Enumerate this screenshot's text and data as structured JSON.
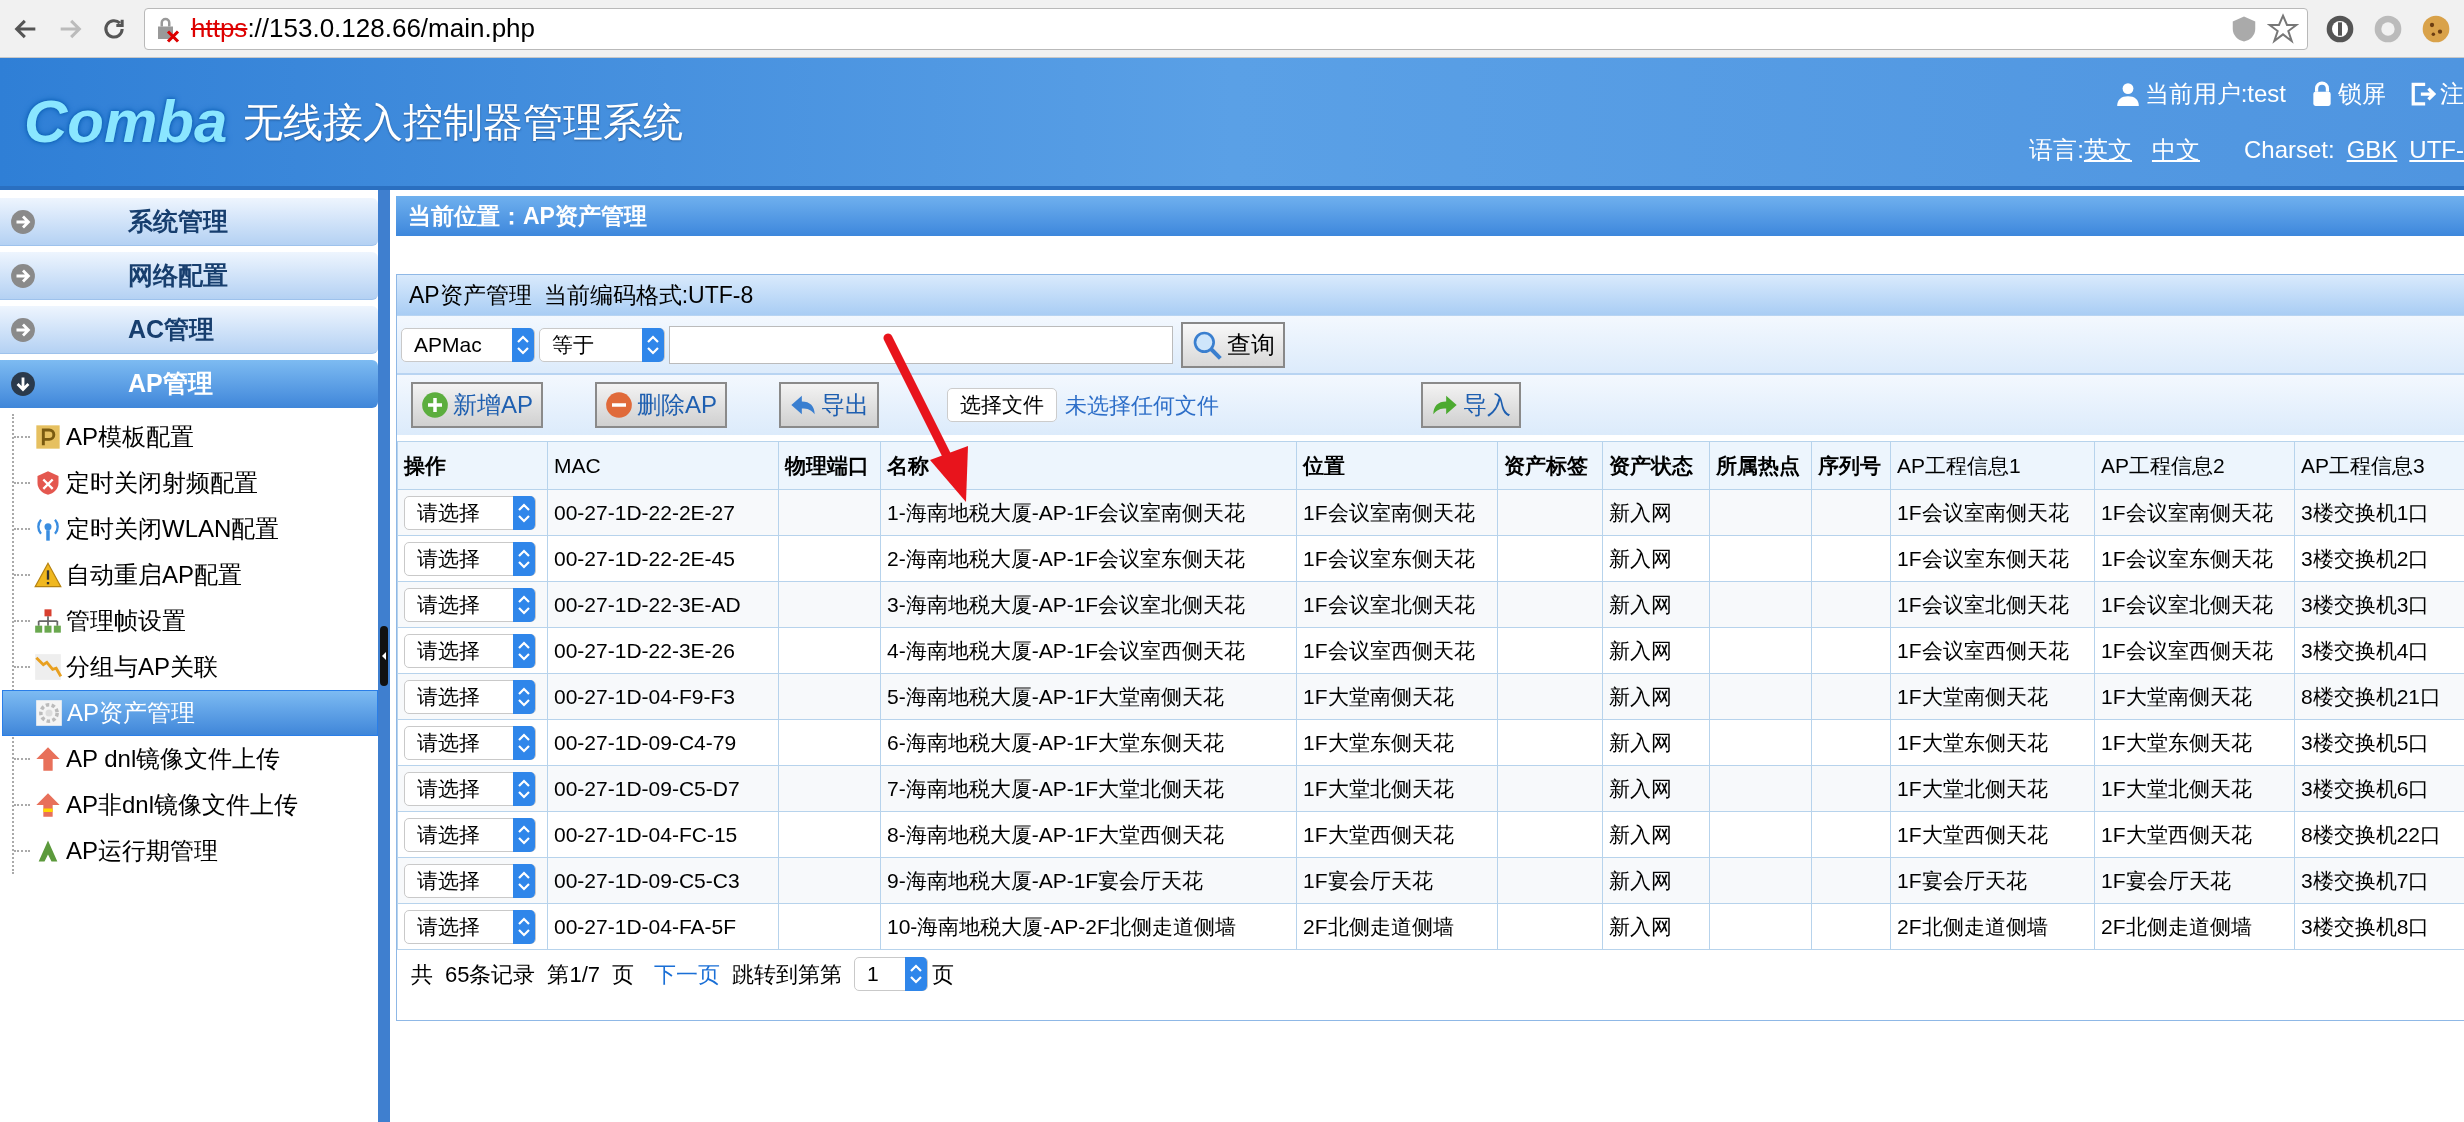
{
  "browser": {
    "url_scheme": "https",
    "url_rest": "://153.0.128.66/main.php"
  },
  "header": {
    "logo": "Comba",
    "title": "无线接入控制器管理系统",
    "user": "当前用户:test",
    "lock": "锁屏",
    "logout": "注",
    "language_label": "语言:",
    "languages": [
      "英文",
      "中文"
    ],
    "charset_label": "Charset:",
    "charsets": [
      "GBK",
      "UTF-"
    ]
  },
  "sidebar": {
    "sections": [
      {
        "label": "系统管理",
        "expanded": false
      },
      {
        "label": "网络配置",
        "expanded": false
      },
      {
        "label": "AC管理",
        "expanded": false
      },
      {
        "label": "AP管理",
        "expanded": true,
        "children": [
          {
            "label": "AP模板配置",
            "kind": "template",
            "selected": false
          },
          {
            "label": "定时关闭射频配置",
            "kind": "shield",
            "selected": false
          },
          {
            "label": "定时关闭WLAN配置",
            "kind": "wifi",
            "selected": false
          },
          {
            "label": "自动重启AP配置",
            "kind": "warning",
            "selected": false
          },
          {
            "label": "管理帧设置",
            "kind": "hierarchy",
            "selected": false
          },
          {
            "label": "分组与AP关联",
            "kind": "chart",
            "selected": false
          },
          {
            "label": "AP资产管理",
            "kind": "gear",
            "selected": true
          },
          {
            "label": "AP dnl镜像文件上传",
            "kind": "upload",
            "selected": false
          },
          {
            "label": "AP非dnl镜像文件上传",
            "kind": "upload-alt",
            "selected": false
          },
          {
            "label": "AP运行期管理",
            "kind": "tree",
            "selected": false
          }
        ]
      }
    ]
  },
  "breadcrumb": "当前位置：AP资产管理",
  "panel": {
    "title": "AP资产管理",
    "encoding": "当前编码格式:UTF-8",
    "search": {
      "field": "APMac",
      "operator": "等于",
      "button": "查询"
    },
    "actions": [
      {
        "label": "新增AP",
        "kind": "add"
      },
      {
        "label": "删除AP",
        "kind": "remove"
      },
      {
        "label": "导出",
        "kind": "export"
      }
    ],
    "file": {
      "button": "选择文件",
      "status": "未选择任何文件"
    },
    "import_button": "导入",
    "table": {
      "columns": [
        "操作",
        "MAC",
        "物理端口",
        "名称",
        "位置",
        "资产标签",
        "资产状态",
        "所属热点",
        "序列号",
        "AP工程信息1",
        "AP工程信息2",
        "AP工程信息3"
      ],
      "rows": [
        {
          "cells": [
            "请选择",
            "00-27-1D-22-2E-27",
            "",
            "1-海南地税大厦-AP-1F会议室南侧天花",
            "1F会议室南侧天花",
            "",
            "新入网",
            "",
            "",
            "1F会议室南侧天花",
            "1F会议室南侧天花",
            "3楼交换机1口"
          ]
        },
        {
          "cells": [
            "请选择",
            "00-27-1D-22-2E-45",
            "",
            "2-海南地税大厦-AP-1F会议室东侧天花",
            "1F会议室东侧天花",
            "",
            "新入网",
            "",
            "",
            "1F会议室东侧天花",
            "1F会议室东侧天花",
            "3楼交换机2口"
          ]
        },
        {
          "cells": [
            "请选择",
            "00-27-1D-22-3E-AD",
            "",
            "3-海南地税大厦-AP-1F会议室北侧天花",
            "1F会议室北侧天花",
            "",
            "新入网",
            "",
            "",
            "1F会议室北侧天花",
            "1F会议室北侧天花",
            "3楼交换机3口"
          ]
        },
        {
          "cells": [
            "请选择",
            "00-27-1D-22-3E-26",
            "",
            "4-海南地税大厦-AP-1F会议室西侧天花",
            "1F会议室西侧天花",
            "",
            "新入网",
            "",
            "",
            "1F会议室西侧天花",
            "1F会议室西侧天花",
            "3楼交换机4口"
          ]
        },
        {
          "cells": [
            "请选择",
            "00-27-1D-04-F9-F3",
            "",
            "5-海南地税大厦-AP-1F大堂南侧天花",
            "1F大堂南侧天花",
            "",
            "新入网",
            "",
            "",
            "1F大堂南侧天花",
            "1F大堂南侧天花",
            "8楼交换机21口"
          ]
        },
        {
          "cells": [
            "请选择",
            "00-27-1D-09-C4-79",
            "",
            "6-海南地税大厦-AP-1F大堂东侧天花",
            "1F大堂东侧天花",
            "",
            "新入网",
            "",
            "",
            "1F大堂东侧天花",
            "1F大堂东侧天花",
            "3楼交换机5口"
          ]
        },
        {
          "cells": [
            "请选择",
            "00-27-1D-09-C5-D7",
            "",
            "7-海南地税大厦-AP-1F大堂北侧天花",
            "1F大堂北侧天花",
            "",
            "新入网",
            "",
            "",
            "1F大堂北侧天花",
            "1F大堂北侧天花",
            "3楼交换机6口"
          ]
        },
        {
          "cells": [
            "请选择",
            "00-27-1D-04-FC-15",
            "",
            "8-海南地税大厦-AP-1F大堂西侧天花",
            "1F大堂西侧天花",
            "",
            "新入网",
            "",
            "",
            "1F大堂西侧天花",
            "1F大堂西侧天花",
            "8楼交换机22口"
          ]
        },
        {
          "cells": [
            "请选择",
            "00-27-1D-09-C5-C3",
            "",
            "9-海南地税大厦-AP-1F宴会厅天花",
            "1F宴会厅天花",
            "",
            "新入网",
            "",
            "",
            "1F宴会厅天花",
            "1F宴会厅天花",
            "3楼交换机7口"
          ]
        },
        {
          "cells": [
            "请选择",
            "00-27-1D-04-FA-5F",
            "",
            "10-海南地税大厦-AP-2F北侧走道侧墙",
            "2F北侧走道侧墙",
            "",
            "新入网",
            "",
            "",
            "2F北侧走道侧墙",
            "2F北侧走道侧墙",
            "3楼交换机8口"
          ]
        }
      ]
    },
    "pagination": {
      "total_prefix": "共",
      "total": "65条记录",
      "page": "第1/7",
      "page_suffix": "页",
      "next": "下一页",
      "jump_label": "跳转到第第",
      "jump_value": "1",
      "jump_suffix": "页"
    }
  }
}
